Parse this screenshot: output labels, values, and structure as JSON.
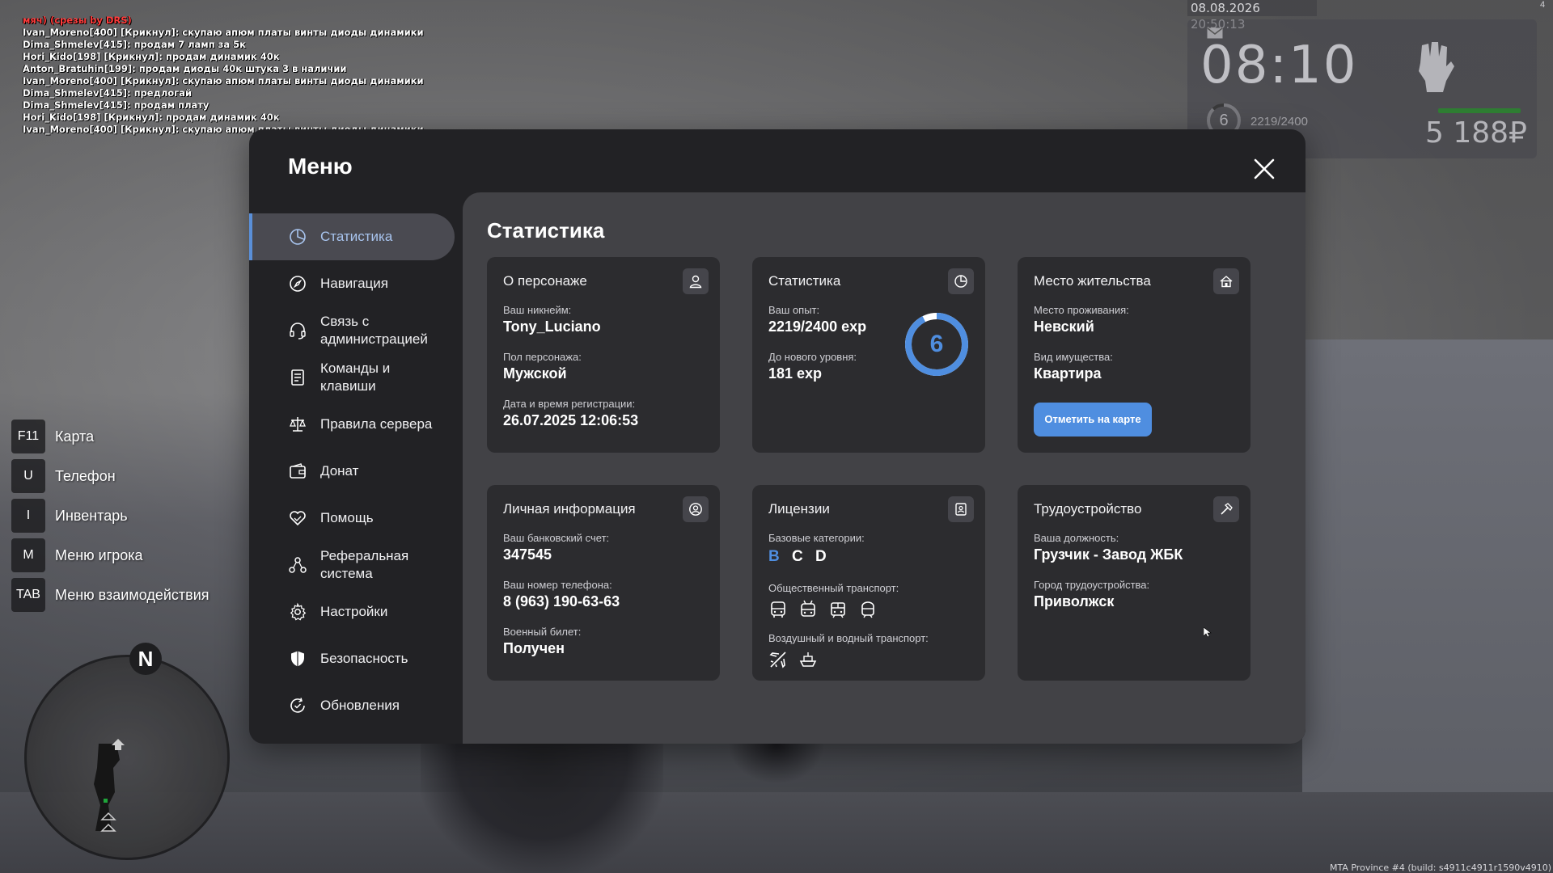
{
  "chat": [
    {
      "text": "мяч) (срезы by DRS)",
      "color": "red"
    },
    {
      "text": "Ivan_Moreno[400] [Крикнул]: скупаю апюм платы винты диоды динамики"
    },
    {
      "text": "Dima_Shmelev[415]: продам 7 ламп за 5к"
    },
    {
      "text": "Hori_Kido[198] [Крикнул]: продам динамик 40к"
    },
    {
      "text": "Anton_Bratuhin[199]: продам диоды 40к штука 3 в наличии"
    },
    {
      "text": "Ivan_Moreno[400] [Крикнул]: скупаю апюм платы винты диоды динамики"
    },
    {
      "text": "Dima_Shmelev[415]: предлогай"
    },
    {
      "text": "Dima_Shmelev[415]: продам плату"
    },
    {
      "text": "Hori_Kido[198] [Крикнул]: продам динамик 40к"
    },
    {
      "text": "Ivan_Moreno[400] [Крикнул]: скупаю апюм платы винты диоды динамики"
    }
  ],
  "hud": {
    "datetime": "08.08.2026 20:50:13",
    "corner": "4",
    "time": "08:10",
    "level": "6",
    "exp": "2219/2400",
    "money": "5 188₽",
    "build": "MTA Province #4 (build: s4911c4911r1590v4910)"
  },
  "hotkeys": [
    {
      "key": "F11",
      "label": "Карта"
    },
    {
      "key": "U",
      "label": "Телефон"
    },
    {
      "key": "I",
      "label": "Инвентарь"
    },
    {
      "key": "M",
      "label": "Меню игрока"
    },
    {
      "key": "TAB",
      "label": "Меню взаимодействия"
    }
  ],
  "radar": {
    "north": "N"
  },
  "menu": {
    "title": "Меню",
    "nav": [
      {
        "label": "Статистика",
        "icon": "pie-chart-icon",
        "active": true
      },
      {
        "label": "Навигация",
        "icon": "compass-icon"
      },
      {
        "label": "Связь с администрацией",
        "icon": "headset-icon"
      },
      {
        "label": "Команды и клавиши",
        "icon": "document-list-icon"
      },
      {
        "label": "Правила сервера",
        "icon": "scales-icon"
      },
      {
        "label": "Донат",
        "icon": "wallet-icon"
      },
      {
        "label": "Помощь",
        "icon": "heart-hand-icon"
      },
      {
        "label": "Реферальная система",
        "icon": "people-network-icon"
      },
      {
        "label": "Настройки",
        "icon": "gear-icon"
      },
      {
        "label": "Безопасность",
        "icon": "shield-icon"
      },
      {
        "label": "Обновления",
        "icon": "refresh-check-icon"
      }
    ]
  },
  "content": {
    "title": "Статистика",
    "character": {
      "title": "О персонаже",
      "nick_label": "Ваш никнейм:",
      "nick": "Tony_Luciano",
      "gender_label": "Пол персонажа:",
      "gender": "Мужской",
      "reg_label": "Дата и время регистрации:",
      "reg": "26.07.2025 12:06:53"
    },
    "stats": {
      "title": "Статистика",
      "exp_label": "Ваш опыт:",
      "exp": "2219/2400 exp",
      "next_label": "До нового уровня:",
      "next": "181 exp",
      "level": "6",
      "progress": 0.9246
    },
    "residence": {
      "title": "Место жительства",
      "place_label": "Место проживания:",
      "place": "Невский",
      "type_label": "Вид имущества:",
      "type": "Квартира",
      "button": "Отметить на карте"
    },
    "personal": {
      "title": "Личная информация",
      "bank_label": "Ваш банковский счет:",
      "bank": "347545",
      "phone_label": "Ваш номер телефона:",
      "phone": "8 (963) 190-63-63",
      "military_label": "Военный билет:",
      "military": "Получен"
    },
    "licenses": {
      "title": "Лицензии",
      "base_label": "Базовые категории:",
      "categories": [
        {
          "letter": "B",
          "color": "#4f8ee0"
        },
        {
          "letter": "C",
          "color": "#ffffff"
        },
        {
          "letter": "D",
          "color": "#ffffff"
        }
      ],
      "public_label": "Общественный транспорт:",
      "public_icons": [
        "bus-icon",
        "trolleybus-icon",
        "tram-icon",
        "train-icon"
      ],
      "air_label": "Воздушный и водный транспорт:",
      "air_icons": [
        "airplane-icon",
        "boat-icon"
      ]
    },
    "employment": {
      "title": "Трудоустройство",
      "position_label": "Ваша должность:",
      "position": "Грузчик - Завод ЖБК",
      "city_label": "Город трудоустройства:",
      "city": "Приволжск"
    }
  },
  "colors": {
    "accent": "#4f8ee0",
    "panel": "#222225",
    "content": "#424246",
    "card": "#2c2c2f"
  }
}
